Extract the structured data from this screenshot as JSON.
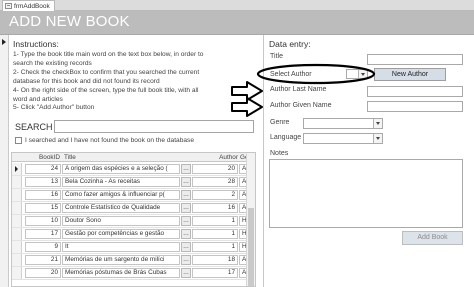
{
  "form_tab": {
    "label": "frmAddBook",
    "icon": "form-icon"
  },
  "header": {
    "title": "ADD NEW BOOK"
  },
  "instructions": {
    "title": "Instructions:",
    "lines": [
      "1- Type the book title main word on the text box below, in order to",
      "search the existing records",
      "2- Check the checkBox to confirm that you searched the current",
      "database for this book and did not found its record",
      "4- On the right side of the screen, type the full book title, with all",
      "word and articles",
      "5- Click \"Add Author\" button"
    ]
  },
  "search": {
    "label": "SEARCH BOX",
    "value": ""
  },
  "confirm": {
    "label": "I searched and I have not found the book on the database",
    "checked": false
  },
  "grid": {
    "headers": {
      "book_id": "BookID",
      "title": "Title",
      "author": "Author",
      "genre": "Ge"
    },
    "rows": [
      {
        "book_id": "24",
        "title": "A origem das espécies e a seleção (",
        "author": "20",
        "genre": "Ac",
        "current": true
      },
      {
        "book_id": "13",
        "title": "Bela Cozinha - As receitas",
        "author": "28",
        "genre": "Ac"
      },
      {
        "book_id": "16",
        "title": "Como fazer amigos & influenciar p(",
        "author": "2",
        "genre": "Ac"
      },
      {
        "book_id": "15",
        "title": "Controle Estatístico de Qualidade",
        "author": "16",
        "genre": "Ac"
      },
      {
        "book_id": "10",
        "title": "Doutor Sono",
        "author": "1",
        "genre": "Ho"
      },
      {
        "book_id": "17",
        "title": "Gestão por competências e gestão",
        "author": "1",
        "genre": "Ho"
      },
      {
        "book_id": "9",
        "title": "It",
        "author": "1",
        "genre": "Ho"
      },
      {
        "book_id": "21",
        "title": "Memórias de um sargento de milíci",
        "author": "18",
        "genre": "Ac"
      },
      {
        "book_id": "20",
        "title": "Memórias póstumas de Brás Cubas",
        "author": "17",
        "genre": "Ac"
      }
    ]
  },
  "entry": {
    "title": "Data entry:",
    "title_label": "Title",
    "select_author_label": "Select Author",
    "new_author_button": "New Author",
    "author_last_name_label": "Author Last Name",
    "author_given_name_label": "Author Given Name",
    "genre_label": "Genre",
    "language_label": "Language",
    "notes_label": "Notes",
    "add_book_button": "Add Book"
  },
  "colors": {
    "header_bg": "#bcbcbc",
    "button_bg": "#d5dde7",
    "annotation": "#000000"
  }
}
